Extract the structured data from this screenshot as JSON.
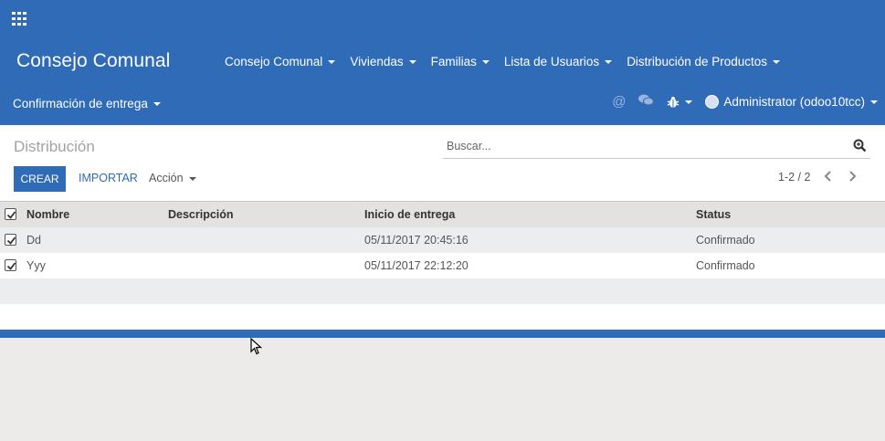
{
  "topbar": {
    "brand": "Consejo Comunal",
    "menu": [
      "Consejo Comunal",
      "Viviendas",
      "Familias",
      "Lista de Usuarios",
      "Distribución de Productos"
    ],
    "second_menu": "Confirmación de entrega",
    "user": "Administrator (odoo10tcc)",
    "icons": [
      "apps-grid-icon",
      "at-icon",
      "chat-icon",
      "bug-icon"
    ],
    "color": "#2f6bb7"
  },
  "control": {
    "breadcrumb": "Distribución",
    "search_placeholder": "Buscar...",
    "create_label": "CREAR",
    "import_label": "IMPORTAR",
    "action_label": "Acción",
    "pager": "1-2 / 2"
  },
  "table": {
    "columns": [
      "Nombre",
      "Descripción",
      "Inicio de entrega",
      "Status"
    ],
    "rows": [
      {
        "name": "Dd",
        "description": "",
        "start": "05/11/2017 20:45:16",
        "status": "Confirmado"
      },
      {
        "name": "Yyy",
        "description": "",
        "start": "05/11/2017 22:12:20",
        "status": "Confirmado"
      }
    ]
  }
}
